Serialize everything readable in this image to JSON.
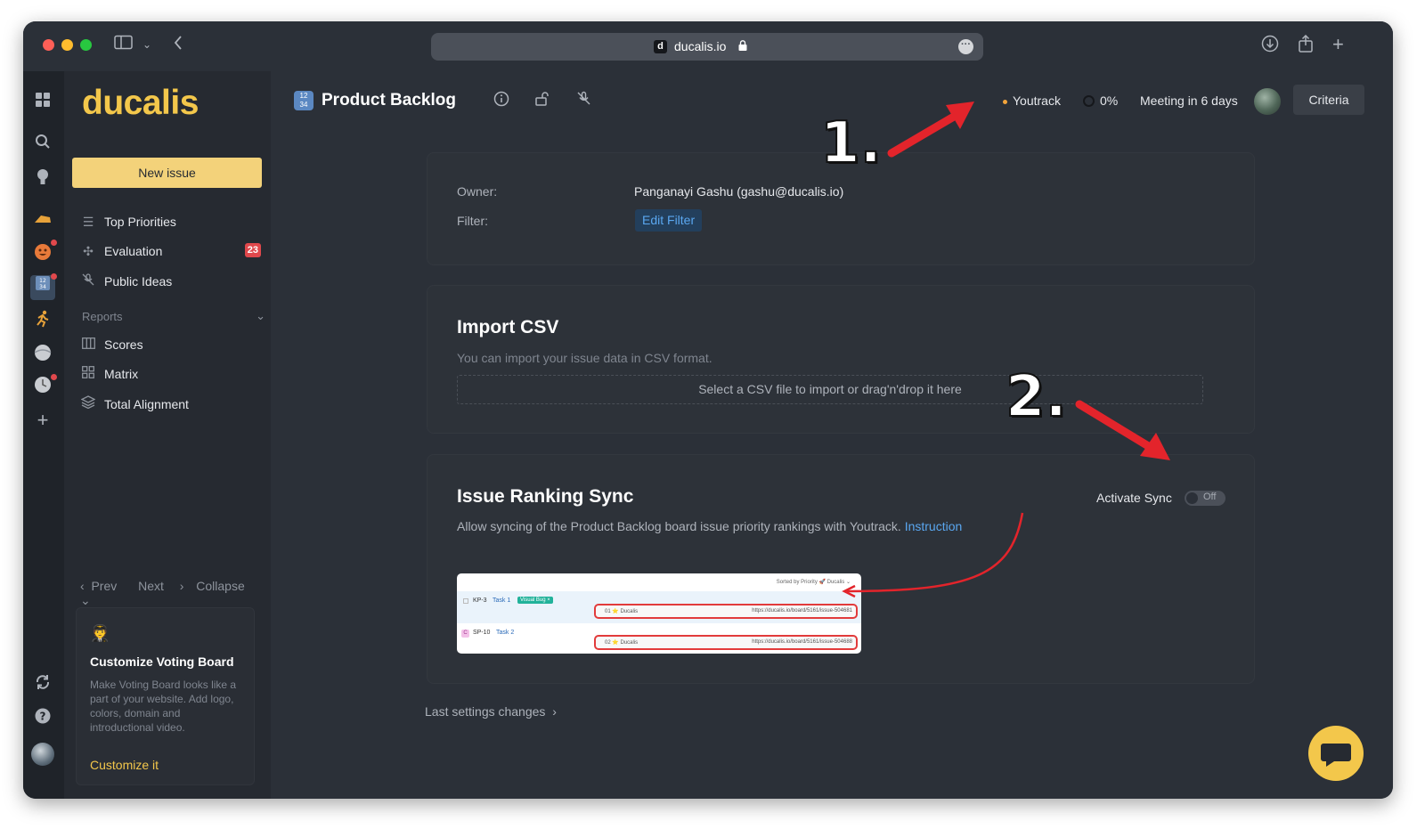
{
  "browser": {
    "url": "ducalis.io",
    "favicon_letter": "d"
  },
  "sidebar": {
    "logo": "ducalis",
    "new_issue": "New issue",
    "items": [
      {
        "label": "Top Priorities",
        "icon": "list-icon"
      },
      {
        "label": "Evaluation",
        "icon": "evaluation-icon",
        "badge": "23"
      },
      {
        "label": "Public Ideas",
        "icon": "no-mic-icon"
      }
    ],
    "reports_label": "Reports",
    "reports": [
      {
        "label": "Scores",
        "icon": "columns-icon"
      },
      {
        "label": "Matrix",
        "icon": "grid-icon"
      },
      {
        "label": "Total Alignment",
        "icon": "layers-icon"
      }
    ],
    "pager": {
      "prev": "Prev",
      "next": "Next",
      "collapse": "Collapse"
    },
    "promo": {
      "emoji": "🧑‍✈️",
      "title": "Customize Voting Board",
      "text": "Make Voting Board looks like a part of your website. Add logo, colors, domain and introductional video.",
      "link": "Customize it"
    }
  },
  "header": {
    "board_icon_text": "12 34",
    "title": "Product Backlog",
    "integration": "Youtrack",
    "progress": "0%",
    "meeting": "Meeting in 6 days",
    "criteria": "Criteria"
  },
  "settings": {
    "owner_label": "Owner:",
    "owner_value": "Panganayi Gashu (gashu@ducalis.io)",
    "filter_label": "Filter:",
    "filter_button": "Edit Filter"
  },
  "import_csv": {
    "title": "Import CSV",
    "subtitle": "You can import your issue data in CSV format.",
    "dropzone": "Select a CSV file to import or drag'n'drop it here"
  },
  "ranking_sync": {
    "title": "Issue Ranking Sync",
    "description": "Allow syncing of the Product Backlog board issue priority rankings with Youtrack.",
    "instruction_link": "Instruction",
    "activate_label": "Activate Sync",
    "toggle_state": "Off",
    "preview": {
      "sorted_by": "Sorted by Priority 🚀 Ducalis ⌄",
      "rows": [
        {
          "key": "KP-3",
          "task": "Task 1",
          "chip": "Visual Bug ×",
          "rank": "01 ⭐ Ducalis",
          "url": "https://ducalis.io/board/5161/issue-504681"
        },
        {
          "key": "SP-10",
          "task": "Task 2",
          "rank": "02 ⭐ Ducalis",
          "url": "https://ducalis.io/board/5161/issue-504688"
        }
      ]
    }
  },
  "last_settings": "Last settings changes",
  "annotations": {
    "one": "1.",
    "two": "2."
  },
  "colors": {
    "accent": "#f3c74b",
    "background": "#2b3038",
    "link": "#5aa7f0",
    "badge": "#e0484c",
    "arrow": "#e3242b"
  }
}
